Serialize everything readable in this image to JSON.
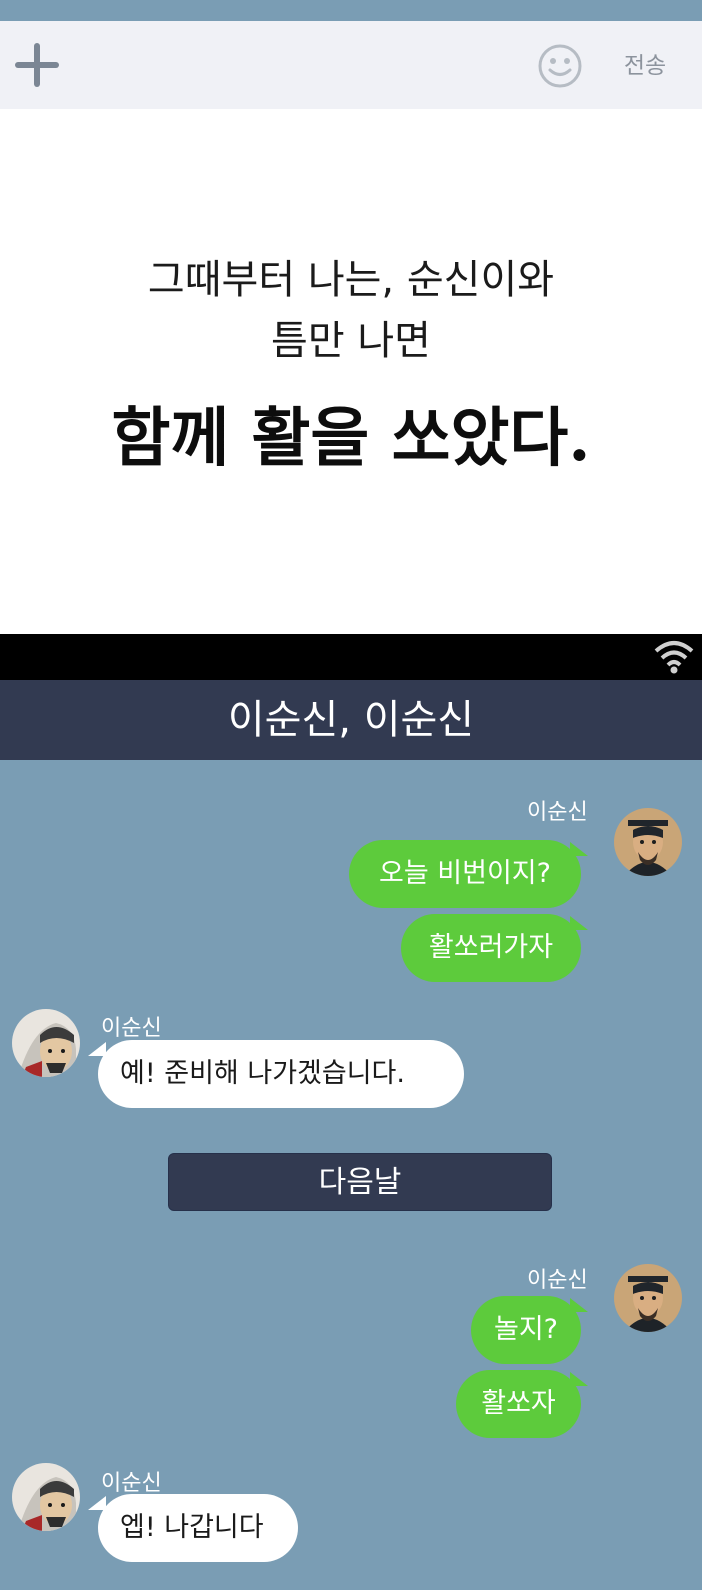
{
  "input_bar": {
    "add_icon": "plus-icon",
    "emoji_icon": "smiley-icon",
    "send_label": "전송"
  },
  "caption": {
    "line1": "그때부터 나는, 순신이와",
    "line2": "틈만 나면",
    "line3": "함께 활을 쏘았다."
  },
  "status_bar": {
    "wifi_icon": "wifi-icon"
  },
  "chat": {
    "title": "이순신, 이순신",
    "messages": [
      {
        "side": "right",
        "sender": "이순신",
        "texts": [
          "오늘 비번이지?",
          "활쏘러가자"
        ]
      },
      {
        "side": "left",
        "sender": "이순신",
        "texts": [
          "예! 준비해 나가겠습니다."
        ]
      },
      {
        "divider": "다음날"
      },
      {
        "side": "right",
        "sender": "이순신",
        "texts": [
          "놀지?",
          "활쏘자"
        ]
      },
      {
        "side": "left",
        "sender": "이순신",
        "texts": [
          "엡! 나갑니다"
        ]
      }
    ]
  },
  "colors": {
    "chat_background": "#7a9db4",
    "header_background": "#323a51",
    "my_bubble": "#5dcb3c",
    "their_bubble": "#ffffff"
  }
}
